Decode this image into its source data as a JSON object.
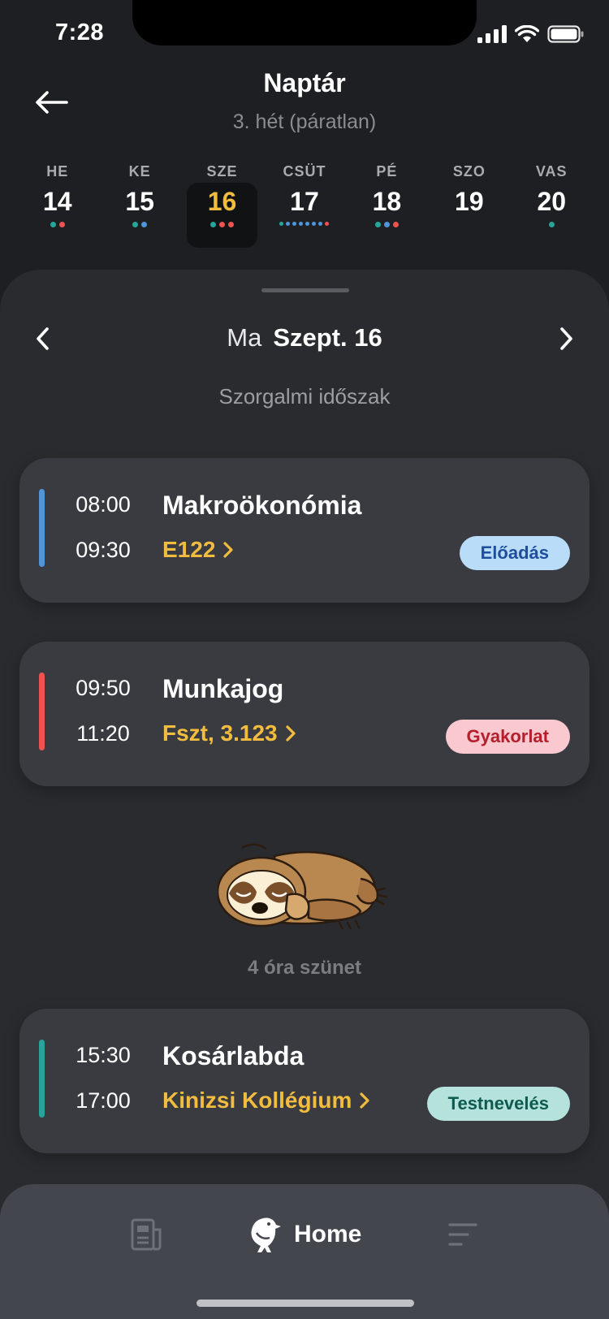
{
  "status": {
    "time": "7:28"
  },
  "header": {
    "title": "Naptár",
    "subtitle": "3. hét (páratlan)"
  },
  "week": [
    {
      "name": "HE",
      "num": "14",
      "dots": [
        "#26a69a",
        "#ef5350"
      ]
    },
    {
      "name": "KE",
      "num": "15",
      "dots": [
        "#26a69a",
        "#4f95d8"
      ]
    },
    {
      "name": "SZE",
      "num": "16",
      "dots": [
        "#26a69a",
        "#ef5350",
        "#ef5350"
      ],
      "selected": true
    },
    {
      "name": "CSÜT",
      "num": "17",
      "dots": [
        "#26a69a",
        "#4f95d8",
        "#4f95d8",
        "#4f95d8",
        "#4f95d8",
        "#4f95d8",
        "#4f95d8",
        "#ef5350"
      ]
    },
    {
      "name": "PÉ",
      "num": "18",
      "dots": [
        "#26a69a",
        "#4f95d8",
        "#ef5350"
      ]
    },
    {
      "name": "SZO",
      "num": "19",
      "dots": []
    },
    {
      "name": "VAS",
      "num": "20",
      "dots": [
        "#26a69a"
      ]
    }
  ],
  "day": {
    "prefix": "Ma",
    "date": "Szept. 16",
    "period": "Szorgalmi időszak"
  },
  "events": [
    {
      "start": "08:00",
      "end": "09:30",
      "name": "Makroökonómia",
      "room": "E122",
      "badge": "Előadás",
      "bar_color": "#4f95d8",
      "badge_bg": "#b9dcf8",
      "badge_fg": "#1f4e9c"
    },
    {
      "start": "09:50",
      "end": "11:20",
      "name": "Munkajog",
      "room": "Fszt, 3.123",
      "badge": "Gyakorlat",
      "bar_color": "#ef5350",
      "badge_bg": "#f9c9cf",
      "badge_fg": "#b3202c"
    },
    {
      "start": "15:30",
      "end": "17:00",
      "name": "Kosárlabda",
      "room": "Kinizsi Kollégium",
      "badge": "Testnevelés",
      "bar_color": "#26a69a",
      "badge_bg": "#b5e3dc",
      "badge_fg": "#0f5a4e"
    }
  ],
  "break": {
    "label": "4 óra szünet"
  },
  "nav": {
    "home_label": "Home"
  },
  "colors": {
    "accent": "#f2bd3e",
    "background": "#1e1f22",
    "sheet": "#2a2b2f",
    "card": "#393b41"
  }
}
